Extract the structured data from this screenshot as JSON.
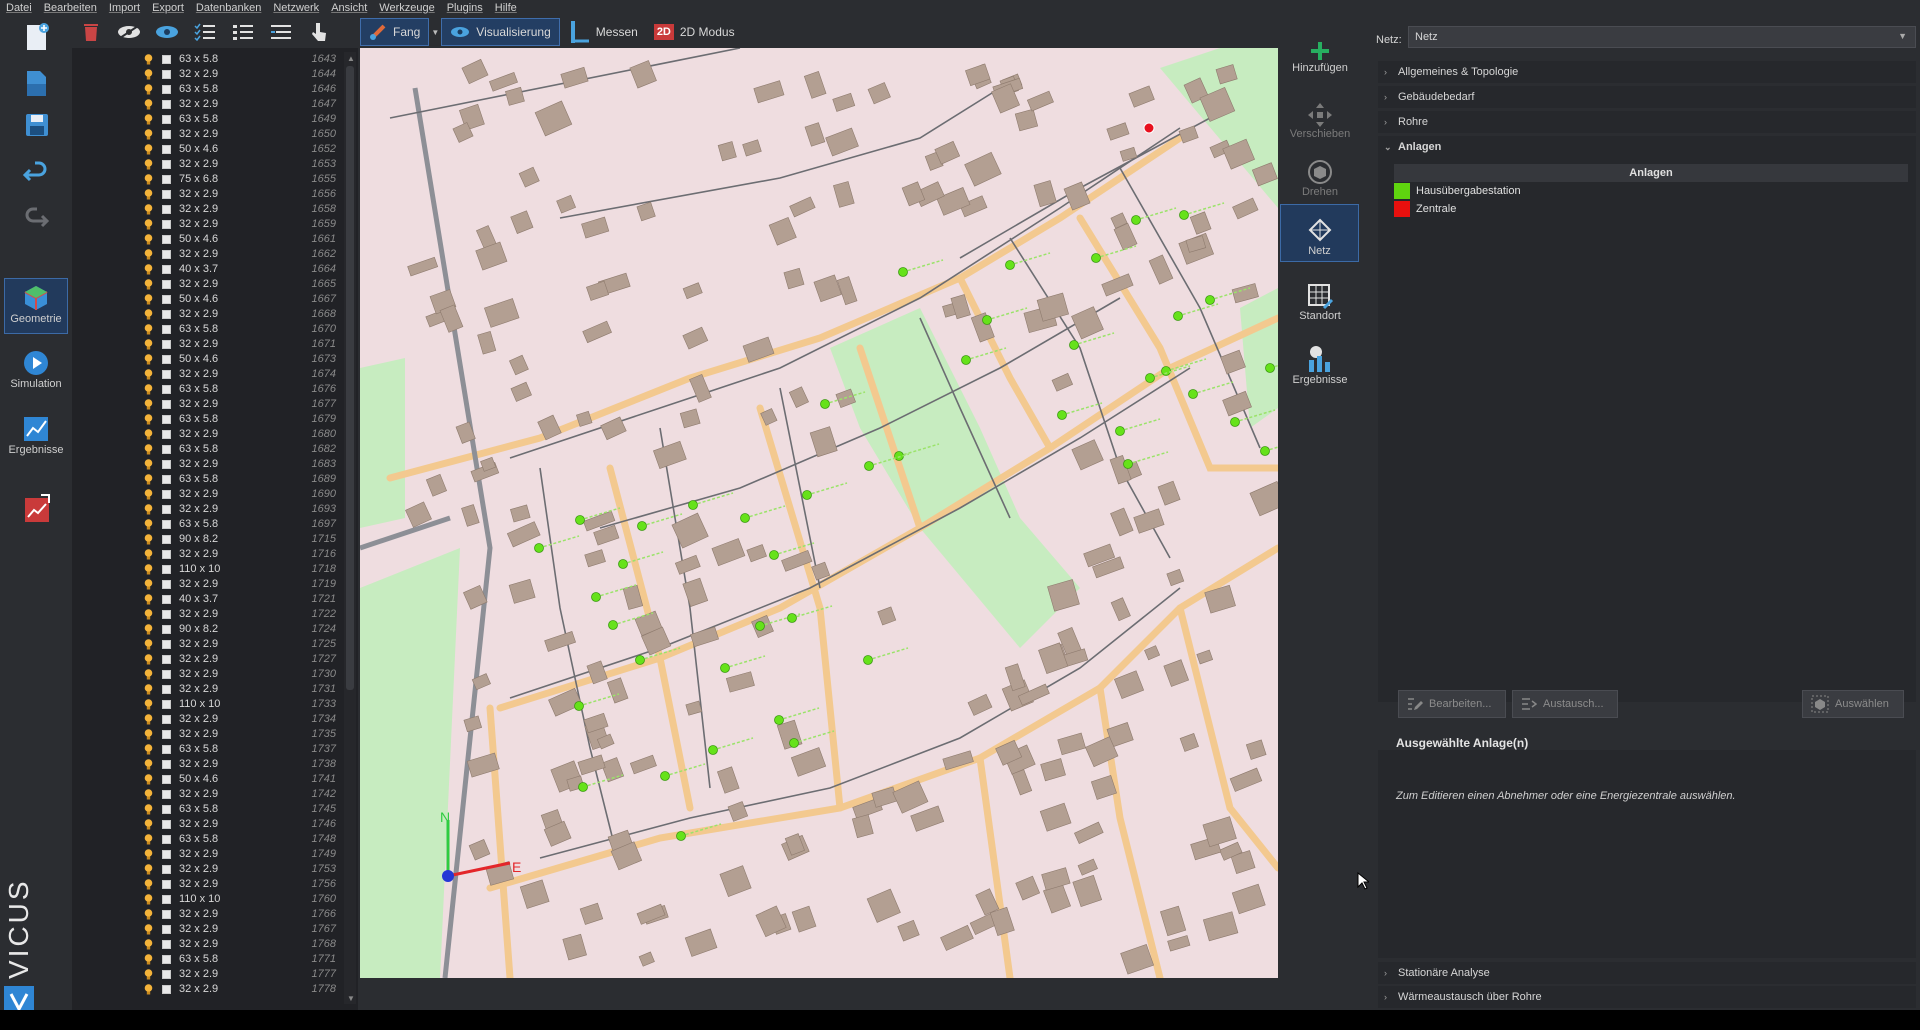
{
  "menu": [
    "Datei",
    "Bearbeiten",
    "Import",
    "Export",
    "Datenbanken",
    "Netzwerk",
    "Ansicht",
    "Werkzeuge",
    "Plugins",
    "Hilfe"
  ],
  "leftbar": {
    "modes": [
      {
        "label": "Geometrie",
        "active": true
      },
      {
        "label": "Simulation",
        "active": false
      },
      {
        "label": "Ergebnisse",
        "active": false
      }
    ],
    "brand": "VICUS"
  },
  "tree_rows": [
    [
      "63 x 5.8",
      "1643"
    ],
    [
      "32 x 2.9",
      "1644"
    ],
    [
      "63 x 5.8",
      "1646"
    ],
    [
      "32 x 2.9",
      "1647"
    ],
    [
      "63 x 5.8",
      "1649"
    ],
    [
      "32 x 2.9",
      "1650"
    ],
    [
      "50 x 4.6",
      "1652"
    ],
    [
      "32 x 2.9",
      "1653"
    ],
    [
      "75 x 6.8",
      "1655"
    ],
    [
      "32 x 2.9",
      "1656"
    ],
    [
      "32 x 2.9",
      "1658"
    ],
    [
      "32 x 2.9",
      "1659"
    ],
    [
      "50 x 4.6",
      "1661"
    ],
    [
      "32 x 2.9",
      "1662"
    ],
    [
      "40 x 3.7",
      "1664"
    ],
    [
      "32 x 2.9",
      "1665"
    ],
    [
      "50 x 4.6",
      "1667"
    ],
    [
      "32 x 2.9",
      "1668"
    ],
    [
      "63 x 5.8",
      "1670"
    ],
    [
      "32 x 2.9",
      "1671"
    ],
    [
      "50 x 4.6",
      "1673"
    ],
    [
      "32 x 2.9",
      "1674"
    ],
    [
      "63 x 5.8",
      "1676"
    ],
    [
      "32 x 2.9",
      "1677"
    ],
    [
      "63 x 5.8",
      "1679"
    ],
    [
      "32 x 2.9",
      "1680"
    ],
    [
      "63 x 5.8",
      "1682"
    ],
    [
      "32 x 2.9",
      "1683"
    ],
    [
      "63 x 5.8",
      "1689"
    ],
    [
      "32 x 2.9",
      "1690"
    ],
    [
      "32 x 2.9",
      "1693"
    ],
    [
      "63 x 5.8",
      "1697"
    ],
    [
      "90 x 8.2",
      "1715"
    ],
    [
      "32 x 2.9",
      "1716"
    ],
    [
      "110 x 10",
      "1718"
    ],
    [
      "32 x 2.9",
      "1719"
    ],
    [
      "40 x 3.7",
      "1721"
    ],
    [
      "32 x 2.9",
      "1722"
    ],
    [
      "90 x 8.2",
      "1724"
    ],
    [
      "32 x 2.9",
      "1725"
    ],
    [
      "32 x 2.9",
      "1727"
    ],
    [
      "32 x 2.9",
      "1730"
    ],
    [
      "32 x 2.9",
      "1731"
    ],
    [
      "110 x 10",
      "1733"
    ],
    [
      "32 x 2.9",
      "1734"
    ],
    [
      "32 x 2.9",
      "1735"
    ],
    [
      "63 x 5.8",
      "1737"
    ],
    [
      "32 x 2.9",
      "1738"
    ],
    [
      "50 x 4.6",
      "1741"
    ],
    [
      "32 x 2.9",
      "1742"
    ],
    [
      "63 x 5.8",
      "1745"
    ],
    [
      "32 x 2.9",
      "1746"
    ],
    [
      "63 x 5.8",
      "1748"
    ],
    [
      "32 x 2.9",
      "1749"
    ],
    [
      "32 x 2.9",
      "1753"
    ],
    [
      "32 x 2.9",
      "1756"
    ],
    [
      "110 x 10",
      "1760"
    ],
    [
      "32 x 2.9",
      "1766"
    ],
    [
      "32 x 2.9",
      "1767"
    ],
    [
      "32 x 2.9",
      "1768"
    ],
    [
      "63 x 5.8",
      "1771"
    ],
    [
      "32 x 2.9",
      "1777"
    ],
    [
      "32 x 2.9",
      "1778"
    ]
  ],
  "map_toolbar": {
    "snap": "Fang",
    "visualization": "Visualisierung",
    "measure": "Messen",
    "mode2d": "2D Modus",
    "mode2d_badge": "2D"
  },
  "axes": {
    "north": "N",
    "east": "E"
  },
  "right_tools": [
    {
      "label": "Hinzufügen",
      "state": "normal"
    },
    {
      "label": "Verschieben",
      "state": "disabled"
    },
    {
      "label": "Drehen",
      "state": "disabled"
    },
    {
      "label": "Netz",
      "state": "active"
    },
    {
      "label": "Standort",
      "state": "normal"
    },
    {
      "label": "Ergebnisse",
      "state": "normal"
    }
  ],
  "props": {
    "net_label": "Netz:",
    "net_value": "Netz",
    "sections_top": [
      "Allgemeines & Topologie",
      "Gebäudebedarf",
      "Rohre"
    ],
    "section_open": "Anlagen",
    "table_header": "Anlagen",
    "table_rows": [
      {
        "name": "Hausübergabestation",
        "color": "#5fd40f"
      },
      {
        "name": "Zentrale",
        "color": "#e8100e"
      }
    ],
    "btn_edit": "Bearbeiten...",
    "btn_replace": "Austausch...",
    "btn_select": "Auswählen",
    "selected_title": "Ausgewählte Anlage(n)",
    "selected_hint": "Zum Editieren einen Abnehmer oder eine Energiezentrale auswählen.",
    "sections_bottom": [
      "Stationäre Analyse",
      "Wärmeaustausch über Rohre"
    ]
  },
  "colors": {
    "accent": "#3c6aa6",
    "map_bg": "#efdde0",
    "node_green": "#66e21a",
    "node_red": "#e8101e",
    "road": "#f3c98f",
    "park": "#c7ecc0"
  }
}
